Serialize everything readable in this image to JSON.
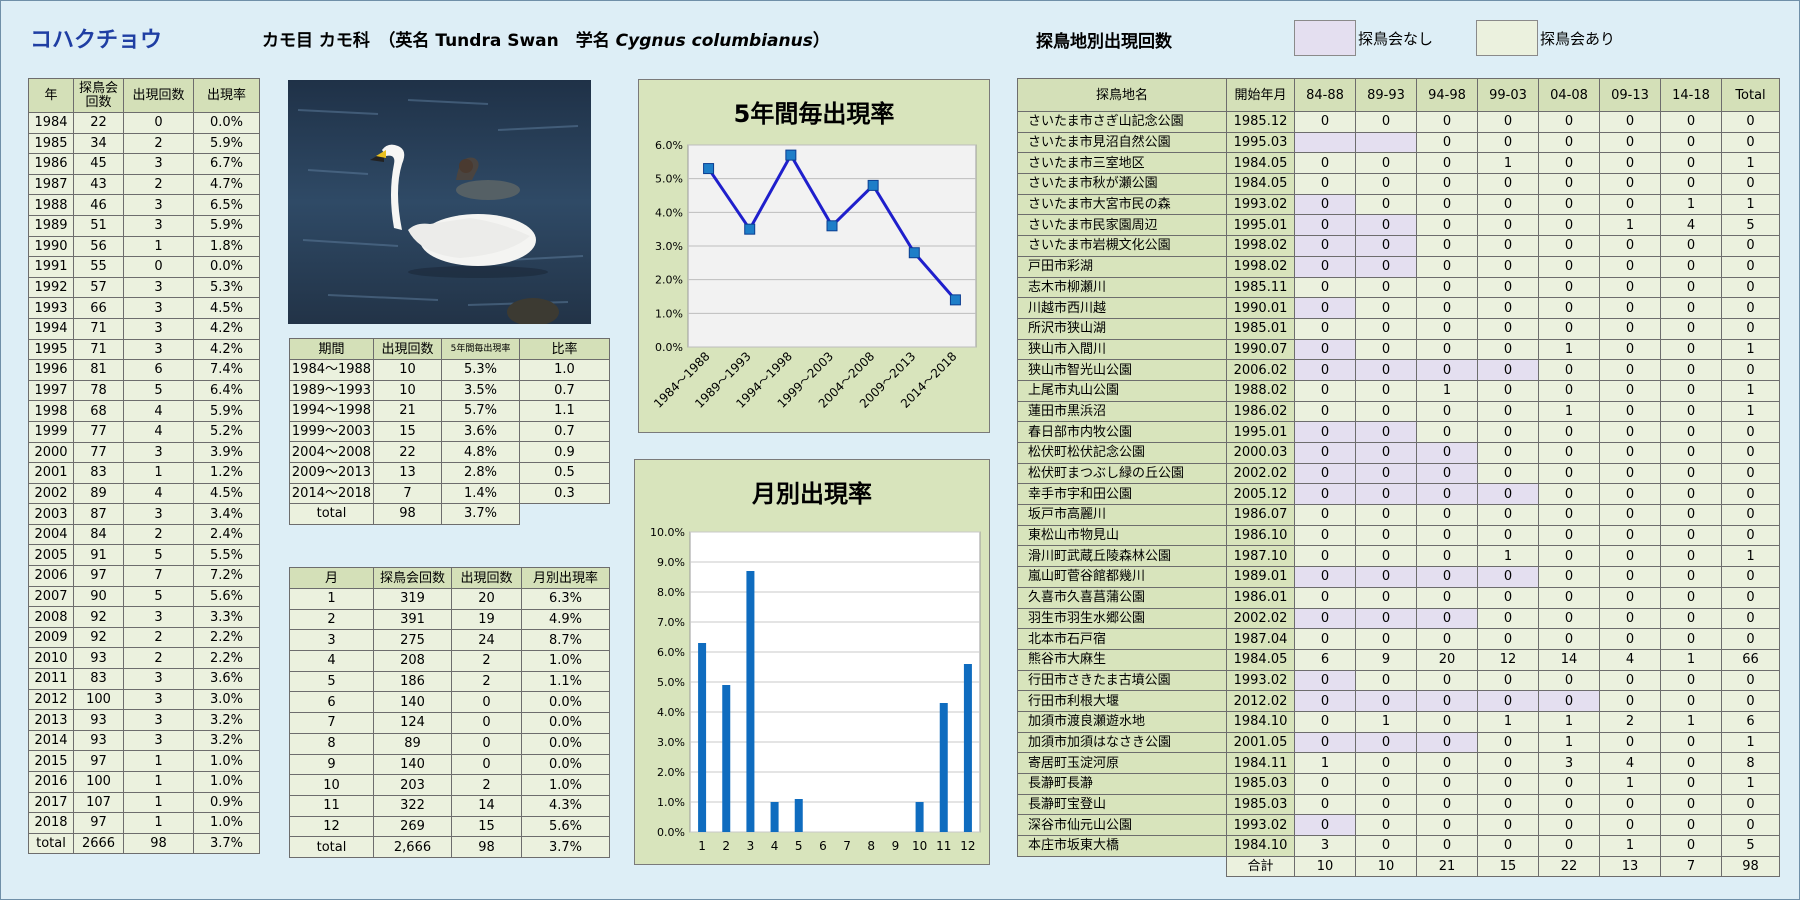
{
  "header": {
    "species": "コハクチョウ",
    "order_family": "カモ目 カモ科",
    "english_label": "（英名",
    "english_name": "Tundra Swan",
    "sci_label": "学名",
    "sci_name": "Cygnus columbianus",
    "closing": "）",
    "site_title": "探鳥地別出現回数",
    "legend_none": "探鳥会なし",
    "legend_held": "探鳥会あり"
  },
  "colors": {
    "background": "#ddeef6",
    "header_cell": "#d4e0b8",
    "data_cell": "#ebf1de",
    "no_meeting": "#e4dff0",
    "line": "#1f1fcc",
    "marker": "#1e7ec8",
    "bar": "#0f6cbf",
    "title": "#1f3ea3"
  },
  "year_table": {
    "headers": [
      "年",
      "探鳥会\n回数",
      "出現回数",
      "出現率"
    ],
    "rows": [
      [
        "1984",
        "22",
        "0",
        "0.0%"
      ],
      [
        "1985",
        "34",
        "2",
        "5.9%"
      ],
      [
        "1986",
        "45",
        "3",
        "6.7%"
      ],
      [
        "1987",
        "43",
        "2",
        "4.7%"
      ],
      [
        "1988",
        "46",
        "3",
        "6.5%"
      ],
      [
        "1989",
        "51",
        "3",
        "5.9%"
      ],
      [
        "1990",
        "56",
        "1",
        "1.8%"
      ],
      [
        "1991",
        "55",
        "0",
        "0.0%"
      ],
      [
        "1992",
        "57",
        "3",
        "5.3%"
      ],
      [
        "1993",
        "66",
        "3",
        "4.5%"
      ],
      [
        "1994",
        "71",
        "3",
        "4.2%"
      ],
      [
        "1995",
        "71",
        "3",
        "4.2%"
      ],
      [
        "1996",
        "81",
        "6",
        "7.4%"
      ],
      [
        "1997",
        "78",
        "5",
        "6.4%"
      ],
      [
        "1998",
        "68",
        "4",
        "5.9%"
      ],
      [
        "1999",
        "77",
        "4",
        "5.2%"
      ],
      [
        "2000",
        "77",
        "3",
        "3.9%"
      ],
      [
        "2001",
        "83",
        "1",
        "1.2%"
      ],
      [
        "2002",
        "89",
        "4",
        "4.5%"
      ],
      [
        "2003",
        "87",
        "3",
        "3.4%"
      ],
      [
        "2004",
        "84",
        "2",
        "2.4%"
      ],
      [
        "2005",
        "91",
        "5",
        "5.5%"
      ],
      [
        "2006",
        "97",
        "7",
        "7.2%"
      ],
      [
        "2007",
        "90",
        "5",
        "5.6%"
      ],
      [
        "2008",
        "92",
        "3",
        "3.3%"
      ],
      [
        "2009",
        "92",
        "2",
        "2.2%"
      ],
      [
        "2010",
        "93",
        "2",
        "2.2%"
      ],
      [
        "2011",
        "83",
        "3",
        "3.6%"
      ],
      [
        "2012",
        "100",
        "3",
        "3.0%"
      ],
      [
        "2013",
        "93",
        "3",
        "3.2%"
      ],
      [
        "2014",
        "93",
        "3",
        "3.2%"
      ],
      [
        "2015",
        "97",
        "1",
        "1.0%"
      ],
      [
        "2016",
        "100",
        "1",
        "1.0%"
      ],
      [
        "2017",
        "107",
        "1",
        "0.9%"
      ],
      [
        "2018",
        "97",
        "1",
        "1.0%"
      ]
    ],
    "total": [
      "total",
      "2666",
      "98",
      "3.7%"
    ]
  },
  "period_table": {
    "headers": [
      "期間",
      "出現回数",
      "5年間毎出現率",
      "比率"
    ],
    "rows": [
      [
        "1984～1988",
        "10",
        "5.3%",
        "1.0"
      ],
      [
        "1989～1993",
        "10",
        "3.5%",
        "0.7"
      ],
      [
        "1994～1998",
        "21",
        "5.7%",
        "1.1"
      ],
      [
        "1999～2003",
        "15",
        "3.6%",
        "0.7"
      ],
      [
        "2004～2008",
        "22",
        "4.8%",
        "0.9"
      ],
      [
        "2009～2013",
        "13",
        "2.8%",
        "0.5"
      ],
      [
        "2014～2018",
        "7",
        "1.4%",
        "0.3"
      ]
    ],
    "total": [
      "total",
      "98",
      "3.7%"
    ]
  },
  "month_table": {
    "headers": [
      "月",
      "探鳥会回数",
      "出現回数",
      "月別出現率"
    ],
    "rows": [
      [
        "1",
        "319",
        "20",
        "6.3%"
      ],
      [
        "2",
        "391",
        "19",
        "4.9%"
      ],
      [
        "3",
        "275",
        "24",
        "8.7%"
      ],
      [
        "4",
        "208",
        "2",
        "1.0%"
      ],
      [
        "5",
        "186",
        "2",
        "1.1%"
      ],
      [
        "6",
        "140",
        "0",
        "0.0%"
      ],
      [
        "7",
        "124",
        "0",
        "0.0%"
      ],
      [
        "8",
        "89",
        "0",
        "0.0%"
      ],
      [
        "9",
        "140",
        "0",
        "0.0%"
      ],
      [
        "10",
        "203",
        "2",
        "1.0%"
      ],
      [
        "11",
        "322",
        "14",
        "4.3%"
      ],
      [
        "12",
        "269",
        "15",
        "5.6%"
      ]
    ],
    "total": [
      "total",
      "2,666",
      "98",
      "3.7%"
    ]
  },
  "site_table": {
    "headers": [
      "探鳥地名",
      "開始年月",
      "84-88",
      "89-93",
      "94-98",
      "99-03",
      "04-08",
      "09-13",
      "14-18",
      "Total"
    ],
    "rows": [
      {
        "name": "さいたま市さぎ山記念公園",
        "start": "1985.12",
        "values": [
          "0",
          "0",
          "0",
          "0",
          "0",
          "0",
          "0",
          "0"
        ],
        "none": 0
      },
      {
        "name": "さいたま市見沼自然公園",
        "start": "1995.03",
        "values": [
          "",
          "",
          "0",
          "0",
          "0",
          "0",
          "0",
          "0"
        ],
        "none": 2
      },
      {
        "name": "さいたま市三室地区",
        "start": "1984.05",
        "values": [
          "0",
          "0",
          "0",
          "1",
          "0",
          "0",
          "0",
          "1"
        ],
        "none": 0
      },
      {
        "name": "さいたま市秋が瀬公園",
        "start": "1984.05",
        "values": [
          "0",
          "0",
          "0",
          "0",
          "0",
          "0",
          "0",
          "0"
        ],
        "none": 0
      },
      {
        "name": "さいたま市大宮市民の森",
        "start": "1993.02",
        "values": [
          "0",
          "0",
          "0",
          "0",
          "0",
          "0",
          "1",
          "1"
        ],
        "none": 1
      },
      {
        "name": "さいたま市民家園周辺",
        "start": "1995.01",
        "values": [
          "0",
          "0",
          "0",
          "0",
          "0",
          "1",
          "4",
          "5"
        ],
        "none": 2
      },
      {
        "name": "さいたま市岩槻文化公園",
        "start": "1998.02",
        "values": [
          "0",
          "0",
          "0",
          "0",
          "0",
          "0",
          "0",
          "0"
        ],
        "none": 2
      },
      {
        "name": "戸田市彩湖",
        "start": "1998.02",
        "values": [
          "0",
          "0",
          "0",
          "0",
          "0",
          "0",
          "0",
          "0"
        ],
        "none": 2
      },
      {
        "name": "志木市柳瀬川",
        "start": "1985.11",
        "values": [
          "0",
          "0",
          "0",
          "0",
          "0",
          "0",
          "0",
          "0"
        ],
        "none": 0
      },
      {
        "name": "川越市西川越",
        "start": "1990.01",
        "values": [
          "0",
          "0",
          "0",
          "0",
          "0",
          "0",
          "0",
          "0"
        ],
        "none": 1
      },
      {
        "name": "所沢市狭山湖",
        "start": "1985.01",
        "values": [
          "0",
          "0",
          "0",
          "0",
          "0",
          "0",
          "0",
          "0"
        ],
        "none": 0
      },
      {
        "name": "狭山市入間川",
        "start": "1990.07",
        "values": [
          "0",
          "0",
          "0",
          "0",
          "1",
          "0",
          "0",
          "1"
        ],
        "none": 1
      },
      {
        "name": "狭山市智光山公園",
        "start": "2006.02",
        "values": [
          "0",
          "0",
          "0",
          "0",
          "0",
          "0",
          "0",
          "0"
        ],
        "none": 4
      },
      {
        "name": "上尾市丸山公園",
        "start": "1988.02",
        "values": [
          "0",
          "0",
          "1",
          "0",
          "0",
          "0",
          "0",
          "1"
        ],
        "none": 0
      },
      {
        "name": "蓮田市黒浜沼",
        "start": "1986.02",
        "values": [
          "0",
          "0",
          "0",
          "0",
          "1",
          "0",
          "0",
          "1"
        ],
        "none": 0
      },
      {
        "name": "春日部市内牧公園",
        "start": "1995.01",
        "values": [
          "0",
          "0",
          "0",
          "0",
          "0",
          "0",
          "0",
          "0"
        ],
        "none": 2
      },
      {
        "name": "松伏町松伏記念公園",
        "start": "2000.03",
        "values": [
          "0",
          "0",
          "0",
          "0",
          "0",
          "0",
          "0",
          "0"
        ],
        "none": 3
      },
      {
        "name": "松伏町まつぶし緑の丘公園",
        "start": "2002.02",
        "values": [
          "0",
          "0",
          "0",
          "0",
          "0",
          "0",
          "0",
          "0"
        ],
        "none": 3
      },
      {
        "name": "幸手市宇和田公園",
        "start": "2005.12",
        "values": [
          "0",
          "0",
          "0",
          "0",
          "0",
          "0",
          "0",
          "0"
        ],
        "none": 4
      },
      {
        "name": "坂戸市高麗川",
        "start": "1986.07",
        "values": [
          "0",
          "0",
          "0",
          "0",
          "0",
          "0",
          "0",
          "0"
        ],
        "none": 0
      },
      {
        "name": "東松山市物見山",
        "start": "1986.10",
        "values": [
          "0",
          "0",
          "0",
          "0",
          "0",
          "0",
          "0",
          "0"
        ],
        "none": 0
      },
      {
        "name": "滑川町武蔵丘陵森林公園",
        "start": "1987.10",
        "values": [
          "0",
          "0",
          "0",
          "1",
          "0",
          "0",
          "0",
          "1"
        ],
        "none": 0
      },
      {
        "name": "嵐山町菅谷館都幾川",
        "start": "1989.01",
        "values": [
          "0",
          "0",
          "0",
          "0",
          "0",
          "0",
          "0",
          "0"
        ],
        "none": 4
      },
      {
        "name": "久喜市久喜菖蒲公園",
        "start": "1986.01",
        "values": [
          "0",
          "0",
          "0",
          "0",
          "0",
          "0",
          "0",
          "0"
        ],
        "none": 0
      },
      {
        "name": "羽生市羽生水郷公園",
        "start": "2002.02",
        "values": [
          "0",
          "0",
          "0",
          "0",
          "0",
          "0",
          "0",
          "0"
        ],
        "none": 3
      },
      {
        "name": "北本市石戸宿",
        "start": "1987.04",
        "values": [
          "0",
          "0",
          "0",
          "0",
          "0",
          "0",
          "0",
          "0"
        ],
        "none": 0
      },
      {
        "name": "熊谷市大麻生",
        "start": "1984.05",
        "values": [
          "6",
          "9",
          "20",
          "12",
          "14",
          "4",
          "1",
          "66"
        ],
        "none": 0
      },
      {
        "name": "行田市さきたま古墳公園",
        "start": "1993.02",
        "values": [
          "0",
          "0",
          "0",
          "0",
          "0",
          "0",
          "0",
          "0"
        ],
        "none": 1
      },
      {
        "name": "行田市利根大堰",
        "start": "2012.02",
        "values": [
          "0",
          "0",
          "0",
          "0",
          "0",
          "0",
          "0",
          "0"
        ],
        "none": 5
      },
      {
        "name": "加須市渡良瀬遊水地",
        "start": "1984.10",
        "values": [
          "0",
          "1",
          "0",
          "1",
          "1",
          "2",
          "1",
          "6"
        ],
        "none": 0
      },
      {
        "name": "加須市加須はなさき公園",
        "start": "2001.05",
        "values": [
          "0",
          "0",
          "0",
          "0",
          "1",
          "0",
          "0",
          "1"
        ],
        "none": 3
      },
      {
        "name": "寄居町玉淀河原",
        "start": "1984.11",
        "values": [
          "1",
          "0",
          "0",
          "0",
          "3",
          "4",
          "0",
          "8"
        ],
        "none": 0
      },
      {
        "name": "長瀞町長瀞",
        "start": "1985.03",
        "values": [
          "0",
          "0",
          "0",
          "0",
          "0",
          "1",
          "0",
          "1"
        ],
        "none": 0
      },
      {
        "name": "長瀞町宝登山",
        "start": "1985.03",
        "values": [
          "0",
          "0",
          "0",
          "0",
          "0",
          "0",
          "0",
          "0"
        ],
        "none": 0
      },
      {
        "name": "深谷市仙元山公園",
        "start": "1993.02",
        "values": [
          "0",
          "0",
          "0",
          "0",
          "0",
          "0",
          "0",
          "0"
        ],
        "none": 1
      },
      {
        "name": "本庄市坂東大橋",
        "start": "1984.10",
        "values": [
          "3",
          "0",
          "0",
          "0",
          "0",
          "1",
          "0",
          "5"
        ],
        "none": 0
      }
    ],
    "total_label": "合計",
    "totals": [
      "10",
      "10",
      "21",
      "15",
      "22",
      "13",
      "7",
      "98"
    ]
  },
  "chart_data": [
    {
      "type": "line",
      "title": "5年間毎出現率",
      "categories": [
        "1984～1988",
        "1989～1993",
        "1994～1998",
        "1999～2003",
        "2004～2008",
        "2009～2013",
        "2014～2018"
      ],
      "values": [
        5.3,
        3.5,
        5.7,
        3.6,
        4.8,
        2.8,
        1.4
      ],
      "unit": "%",
      "ylim": [
        0,
        6
      ],
      "yticks": [
        "0.0%",
        "1.0%",
        "2.0%",
        "3.0%",
        "4.0%",
        "5.0%",
        "6.0%"
      ],
      "grid": true,
      "legend": "none"
    },
    {
      "type": "bar",
      "title": "月別出現率",
      "categories": [
        "1",
        "2",
        "3",
        "4",
        "5",
        "6",
        "7",
        "8",
        "9",
        "10",
        "11",
        "12"
      ],
      "values": [
        6.3,
        4.9,
        8.7,
        1.0,
        1.1,
        0.0,
        0.0,
        0.0,
        0.0,
        1.0,
        4.3,
        5.6
      ],
      "unit": "%",
      "ylim": [
        0,
        10
      ],
      "yticks": [
        "0.0%",
        "1.0%",
        "2.0%",
        "3.0%",
        "4.0%",
        "5.0%",
        "6.0%",
        "7.0%",
        "8.0%",
        "9.0%",
        "10.0%"
      ],
      "grid": true,
      "legend": "none"
    }
  ]
}
